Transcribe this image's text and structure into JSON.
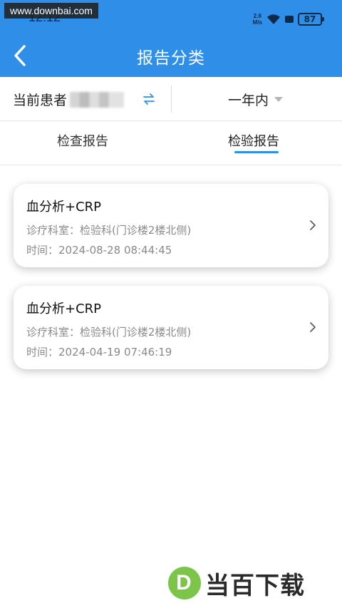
{
  "status_bar": {
    "time": "12:12",
    "net_speed_value": "2.6",
    "net_speed_unit": "M/s",
    "battery": "87"
  },
  "watermark_url": "www.downbai.com",
  "header": {
    "title": "报告分类"
  },
  "filter": {
    "patient_label": "当前患者",
    "range": "一年内"
  },
  "tabs": [
    {
      "label": "检查报告",
      "active": false
    },
    {
      "label": "检验报告",
      "active": true
    }
  ],
  "reports": [
    {
      "name": "血分析+CRP",
      "dept": "诊疗科室：检验科(门诊楼2楼北侧)",
      "time": "时间：2024-08-28 08:44:45"
    },
    {
      "name": "血分析+CRP",
      "dept": "诊疗科室：检验科(门诊楼2楼北侧)",
      "time": "时间：2024-04-19 07:46:19"
    }
  ],
  "brand_logo": {
    "mark": "D",
    "text": "当百下载"
  },
  "colors": {
    "primary": "#2f8fe8",
    "logo_green": "#7cc44a"
  }
}
